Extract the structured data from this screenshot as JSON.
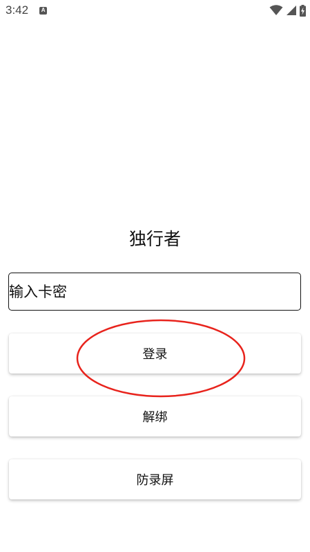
{
  "status_bar": {
    "time": "3:42",
    "notification_icon_letter": "A",
    "icons": [
      "wifi-icon",
      "signal-icon",
      "battery-charging-icon"
    ]
  },
  "app": {
    "title": "独行者"
  },
  "form": {
    "code_placeholder": "输入卡密",
    "code_value": ""
  },
  "buttons": {
    "login": "登录",
    "unbind": "解绑",
    "anti_record": "防录屏"
  },
  "annotation": {
    "color": "#e8231c",
    "target": "login-button"
  }
}
